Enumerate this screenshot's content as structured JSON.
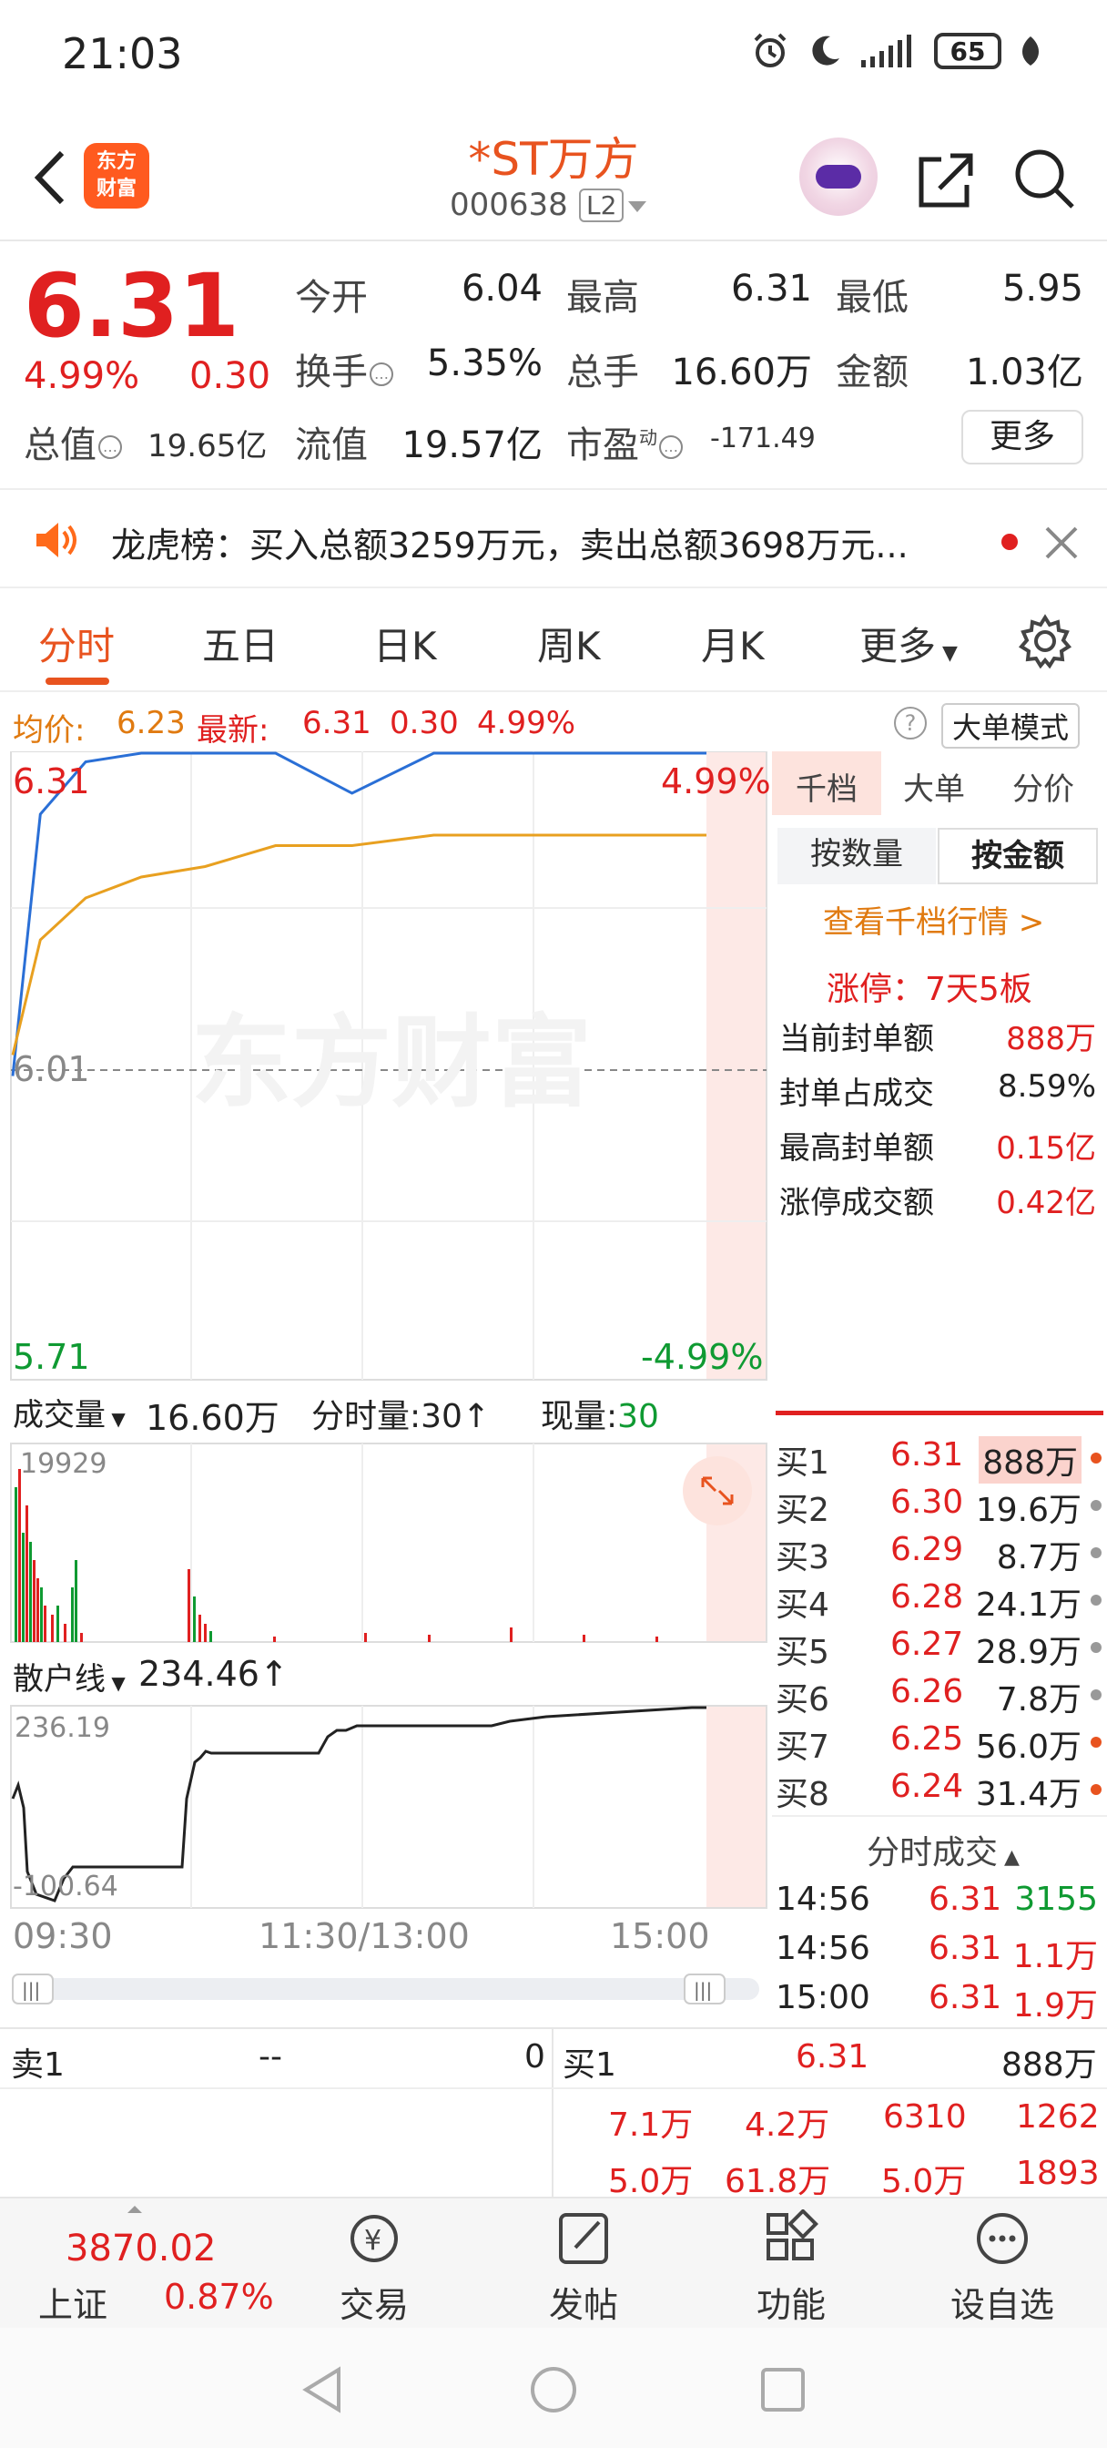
{
  "status_bar": {
    "time": "21:03",
    "battery": "65"
  },
  "header": {
    "stock_name": "*ST万方",
    "stock_code": "000638",
    "level_badge": "L2",
    "logo_text_line1": "东方",
    "logo_text_line2": "财富"
  },
  "quote": {
    "price": "6.31",
    "change_pct": "4.99%",
    "change": "0.30",
    "open_label": "今开",
    "open": "6.04",
    "high_label": "最高",
    "high": "6.31",
    "low_label": "最低",
    "low": "5.95",
    "turnover_label": "换手",
    "turnover": "5.35%",
    "volume_label": "总手",
    "volume": "16.60万",
    "amount_label": "金额",
    "amount": "1.03亿",
    "mktcap_label": "总值",
    "mktcap": "19.65亿",
    "float_label": "流值",
    "float_cap": "19.57亿",
    "pe_label": "市盈",
    "pe_sup": "动",
    "pe": "-171.49",
    "more_button": "更多"
  },
  "notice": {
    "text": "龙虎榜：买入总额3259万元，卖出总额3698万元..."
  },
  "tabs": [
    "分时",
    "五日",
    "日K",
    "周K",
    "月K",
    "更多"
  ],
  "avg_bar": {
    "avg_label": "均价:",
    "avg_value": "6.23",
    "latest_label": "最新:",
    "latest_value": "6.31",
    "change": "0.30",
    "change_pct": "4.99%",
    "mode_button": "大单模式"
  },
  "chart_data": {
    "type": "line",
    "price_axis": {
      "top": "6.31",
      "mid": "6.01",
      "bottom": "5.71",
      "top_pct": "4.99%",
      "bottom_pct": "-4.99%"
    },
    "x_labels": [
      "09:30",
      "11:30/13:00",
      "15:00"
    ],
    "price_series": [
      6.0,
      6.25,
      6.3,
      6.31,
      6.31,
      6.31,
      6.27,
      6.31,
      6.31,
      6.31,
      6.31
    ],
    "avg_series": [
      6.02,
      6.13,
      6.17,
      6.19,
      6.2,
      6.22,
      6.22,
      6.23,
      6.23,
      6.23,
      6.23
    ],
    "volume": {
      "label": "成交量",
      "total": "16.60万",
      "interval_label": "分时量:30",
      "current_label": "现量:",
      "current": "30",
      "max_tick": "19929"
    },
    "retail": {
      "label": "散户线",
      "value": "234.46",
      "max_tick": "236.19",
      "min_tick": "-100.64"
    }
  },
  "right_panel": {
    "tabs": [
      "千档",
      "大单",
      "分价"
    ],
    "seg": [
      "按数量",
      "按金额"
    ],
    "link": "查看千档行情 >",
    "limit_up": "涨停：7天5板",
    "seal_rows": [
      {
        "label": "当前封单额",
        "value": "888万"
      },
      {
        "label": "封单占成交",
        "value": "8.59%"
      },
      {
        "label": "最高封单额",
        "value": "0.15亿"
      },
      {
        "label": "涨停成交额",
        "value": "0.42亿"
      }
    ],
    "bids": [
      {
        "label": "买1",
        "price": "6.31",
        "vol": "888万"
      },
      {
        "label": "买2",
        "price": "6.30",
        "vol": "19.6万"
      },
      {
        "label": "买3",
        "price": "6.29",
        "vol": "8.7万"
      },
      {
        "label": "买4",
        "price": "6.28",
        "vol": "24.1万"
      },
      {
        "label": "买5",
        "price": "6.27",
        "vol": "28.9万"
      },
      {
        "label": "买6",
        "price": "6.26",
        "vol": "7.8万"
      },
      {
        "label": "买7",
        "price": "6.25",
        "vol": "56.0万"
      },
      {
        "label": "买8",
        "price": "6.24",
        "vol": "31.4万"
      }
    ],
    "ticks_title": "分时成交",
    "ticks": [
      {
        "time": "14:56",
        "price": "6.31",
        "vol": "3155"
      },
      {
        "time": "14:56",
        "price": "6.31",
        "vol": "1.1万"
      },
      {
        "time": "15:00",
        "price": "6.31",
        "vol": "1.9万"
      }
    ]
  },
  "summary": {
    "sell1_label": "卖1",
    "sell1_price": "--",
    "sell1_vol": "0",
    "buy1_label": "买1",
    "buy1_price": "6.31",
    "buy1_vol": "888万",
    "row2": [
      "7.1万",
      "4.2万",
      "6310",
      "1262"
    ],
    "row3": [
      "5.0万",
      "61.8万",
      "5.0万",
      "1893"
    ]
  },
  "bottom_nav": {
    "index_value": "3870.02",
    "index_name": "上证",
    "index_pct": "0.87%",
    "items": [
      "交易",
      "发帖",
      "功能",
      "设自选"
    ]
  },
  "watermark": "东方财富"
}
